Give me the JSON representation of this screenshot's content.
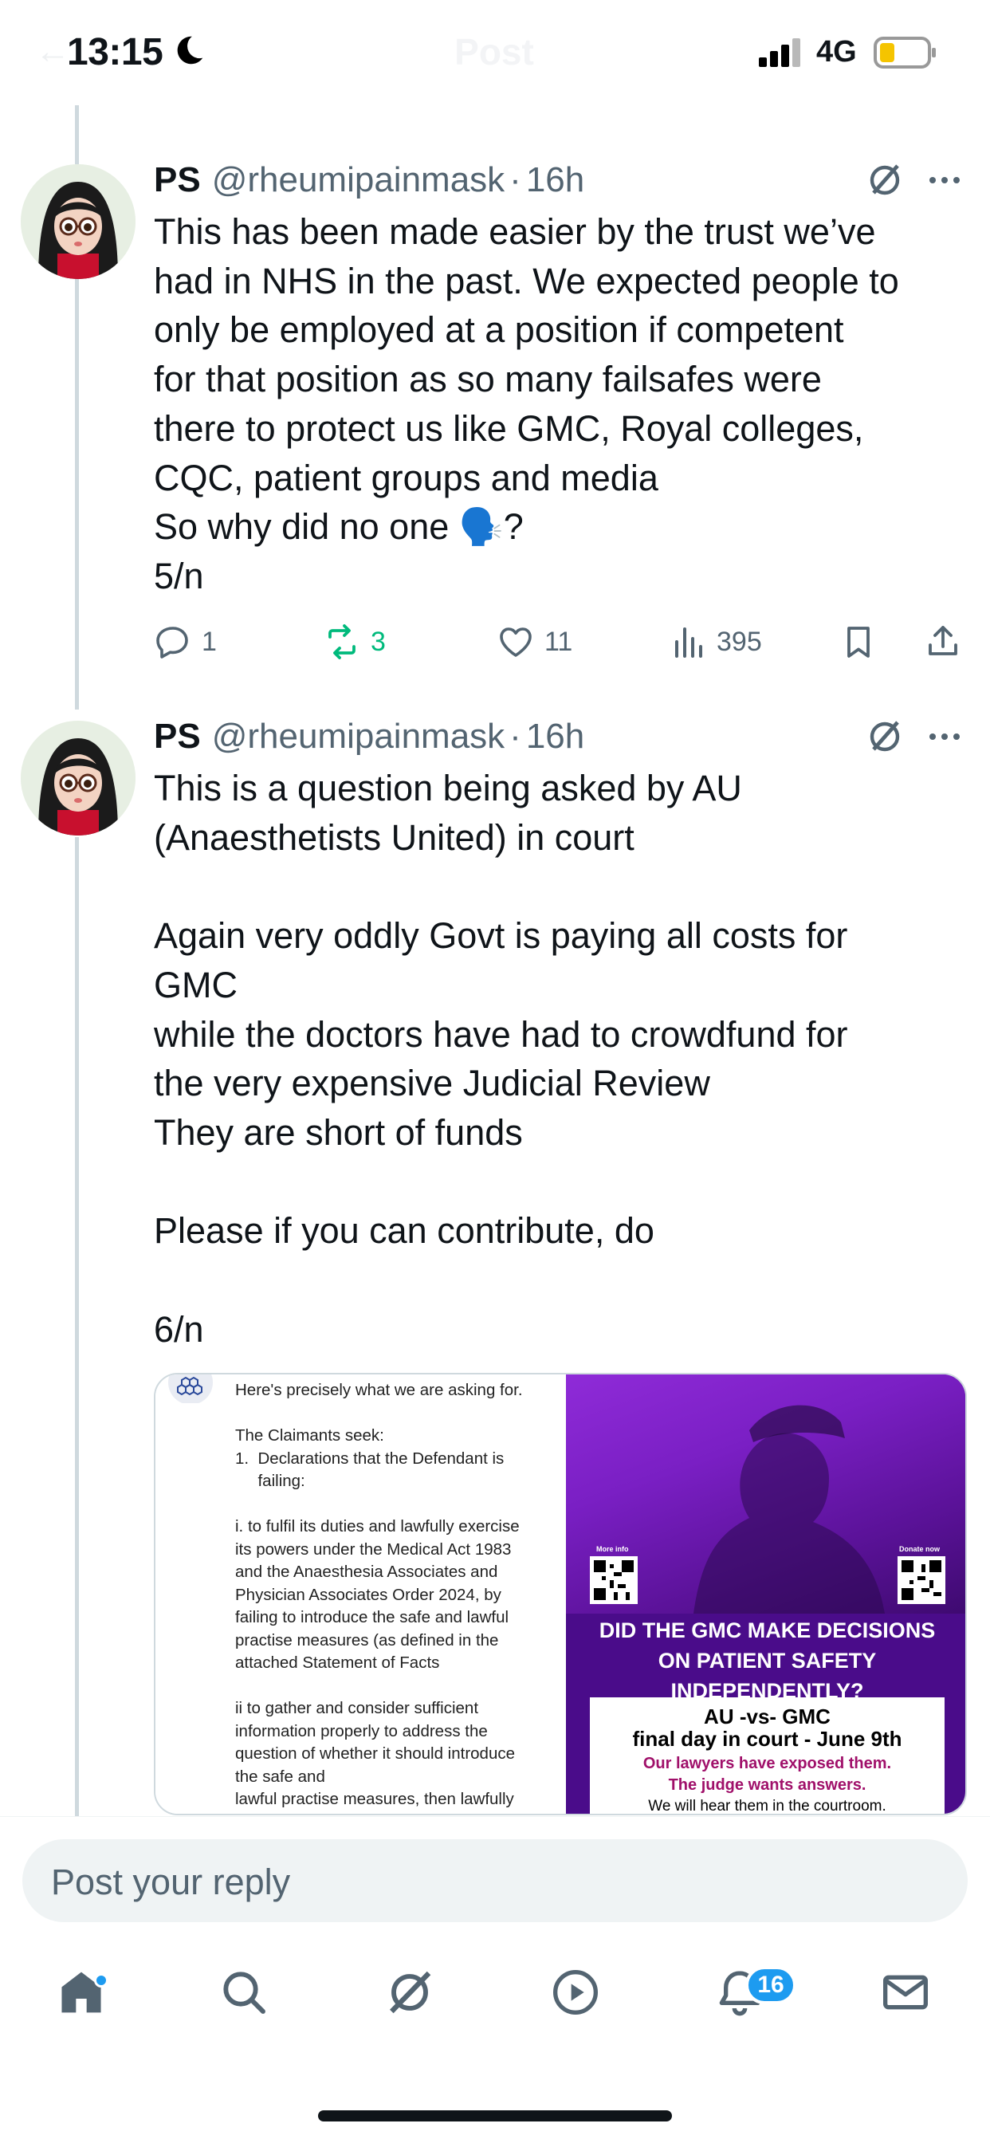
{
  "status_bar": {
    "time": "13:15",
    "network": "4G"
  },
  "header": {
    "back": "←",
    "title": "Post"
  },
  "colors": {
    "accent": "#1d9bf0",
    "retweet_green": "#00ba7c",
    "secondary_text": "#536471",
    "poster_purple": "#4a0c8a"
  },
  "tweets": [
    {
      "name": "PS",
      "handle": "@rheumipainmask",
      "dot": "·",
      "time": "16h",
      "text": "This has been made easier by the trust we’ve\nhad in NHS in the past. We expected people to\nonly be employed at a position if competent\nfor that position as so many failsafes were\nthere to protect us like GMC, Royal colleges,\nCQC, patient groups and media\nSo why did no one 🗣️?\n5/n",
      "replies": "1",
      "reposts": "3",
      "likes": "11",
      "views": "395"
    },
    {
      "name": "PS",
      "handle": "@rheumipainmask",
      "dot": "·",
      "time": "16h",
      "text": "This is a question being asked by AU\n(Anaesthetists United) in court\n\nAgain very oddly Govt is paying all costs for\nGMC\nwhile the doctors have had to crowdfund for\nthe very expensive Judicial Review\nThey are short of funds\n\nPlease if you can contribute, do\n\n6/n"
    }
  ],
  "media": {
    "document_text": "Here's precisely what we are asking for.\n\nThe Claimants seek:\n1.  Declarations that the Defendant is\n     failing:\n\ni. to fulfil its duties and lawfully exercise\nits powers under the Medical Act 1983\nand the Anaesthesia Associates and\nPhysician Associates Order 2024, by\nfailing to introduce the safe and lawful\npractise measures (as defined in the\nattached Statement of Facts\n\nii to gather and consider sufficient\ninformation properly to address the\nquestion of whether it should introduce\nthe safe and\nlawful practise measures, then lawfully",
    "poster": {
      "qr_left_label": "More info",
      "qr_right_label": "Donate now",
      "question": "DID THE GMC MAKE DECISIONS\nON PATIENT SAFETY INDEPENDENTLY?",
      "box_title": "AU -vs- GMC\nfinal day in court - June 9th",
      "box_highlight": "Our lawyers have exposed them.\nThe judge wants answers.",
      "box_footer": "We will hear them in the courtroom."
    }
  },
  "reply_box": {
    "placeholder": "Post your reply"
  },
  "bottom_nav": {
    "items": [
      "home-icon",
      "search-icon",
      "grok-icon",
      "video-icon",
      "notifications-icon",
      "messages-icon"
    ],
    "notification_count": "16"
  }
}
